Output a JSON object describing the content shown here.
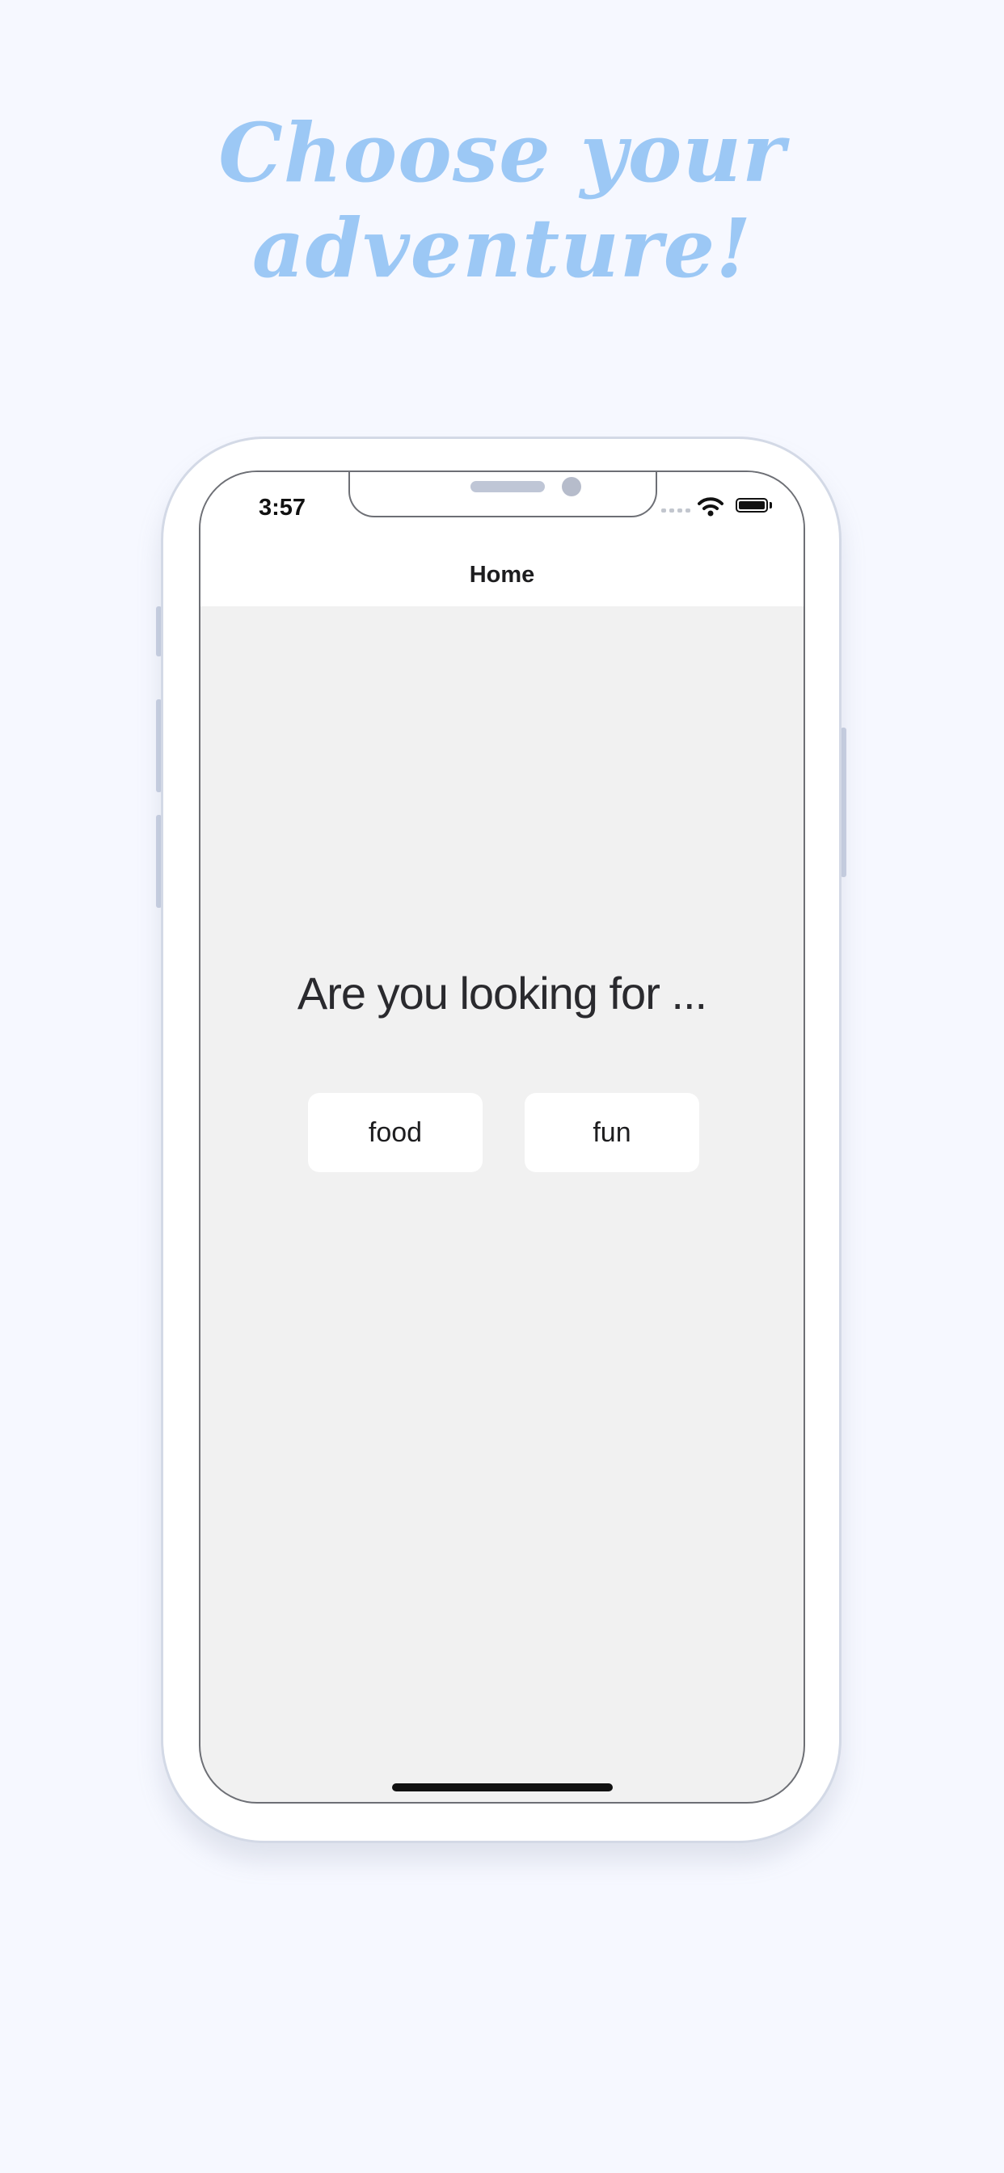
{
  "promo": {
    "headline": "Choose your adventure!"
  },
  "status_bar": {
    "time": "3:57",
    "icons": [
      "cellular-signal-icon",
      "wifi-icon",
      "battery-icon"
    ]
  },
  "nav": {
    "title": "Home"
  },
  "main": {
    "question": "Are you looking for ...",
    "options": [
      {
        "label": "food"
      },
      {
        "label": "fun"
      }
    ]
  },
  "colors": {
    "background": "#f6f8ff",
    "headline": "#9cc8f5",
    "screen_background": "#f1f1f1",
    "button_background": "#ffffff"
  }
}
